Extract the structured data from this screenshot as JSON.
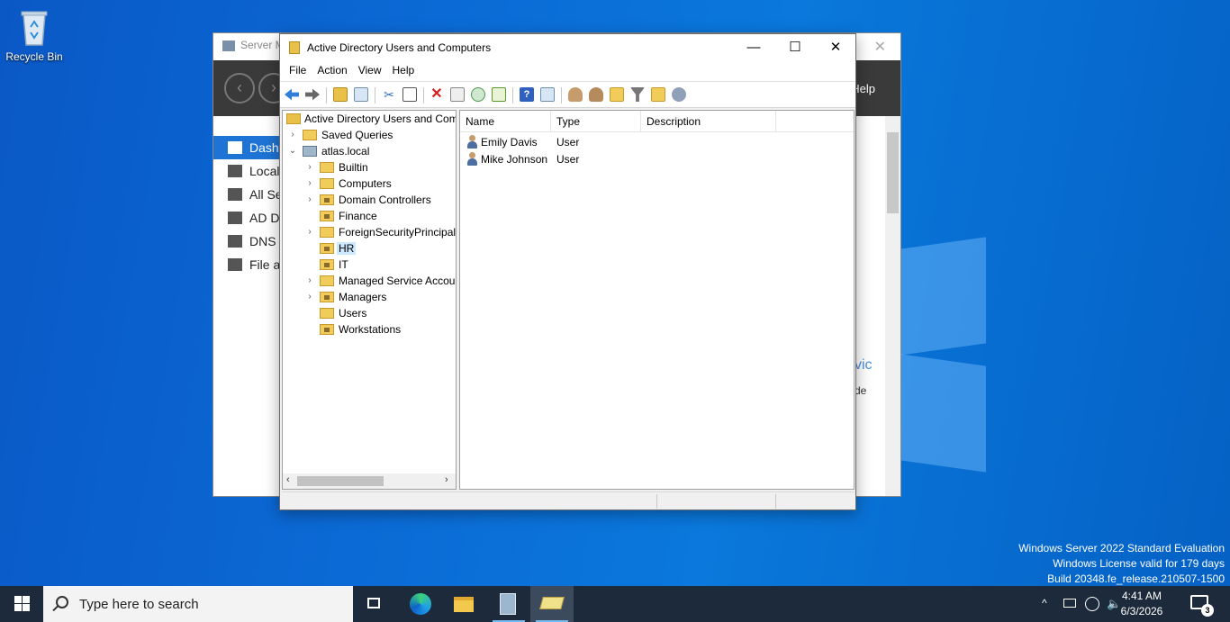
{
  "desktop": {
    "recycle_bin_label": "Recycle Bin",
    "watermark": {
      "line1": "Windows Server 2022 Standard Evaluation",
      "line2": "Windows License valid for 179 days",
      "line3": "Build 20348.fe_release.210507-1500"
    }
  },
  "server_manager": {
    "title": "Server M",
    "help_label": "Help",
    "sidebar": [
      {
        "label": "Dashb",
        "icon": "dashboard-icon",
        "active": true
      },
      {
        "label": "Local",
        "icon": "local-server-icon"
      },
      {
        "label": "All Se",
        "icon": "all-servers-icon"
      },
      {
        "label": "AD D",
        "icon": "ad-ds-icon"
      },
      {
        "label": "DNS",
        "icon": "dns-icon"
      },
      {
        "label": "File a",
        "icon": "file-services-icon"
      }
    ],
    "fragment_1": "vic",
    "fragment_2": "de"
  },
  "aduc": {
    "title": "Active Directory Users and Computers",
    "menu": {
      "file": "File",
      "action": "Action",
      "view": "View",
      "help": "Help"
    },
    "tree": {
      "root": "Active Directory Users and Com",
      "saved_queries": "Saved Queries",
      "domain": "atlas.local",
      "children": [
        {
          "label": "Builtin",
          "expandable": true,
          "ou": false
        },
        {
          "label": "Computers",
          "expandable": true,
          "ou": false
        },
        {
          "label": "Domain Controllers",
          "expandable": true,
          "ou": true
        },
        {
          "label": "Finance",
          "expandable": false,
          "ou": true
        },
        {
          "label": "ForeignSecurityPrincipals",
          "expandable": true,
          "ou": false
        },
        {
          "label": "HR",
          "expandable": false,
          "ou": true,
          "selected": true
        },
        {
          "label": "IT",
          "expandable": false,
          "ou": true
        },
        {
          "label": "Managed Service Accour",
          "expandable": true,
          "ou": false
        },
        {
          "label": "Managers",
          "expandable": true,
          "ou": true
        },
        {
          "label": "Users",
          "expandable": false,
          "ou": false
        },
        {
          "label": "Workstations",
          "expandable": false,
          "ou": true
        }
      ]
    },
    "list": {
      "columns": {
        "name": "Name",
        "type": "Type",
        "description": "Description"
      },
      "rows": [
        {
          "name": "Emily Davis",
          "type": "User",
          "description": ""
        },
        {
          "name": "Mike Johnson",
          "type": "User",
          "description": ""
        }
      ]
    }
  },
  "taskbar": {
    "search_placeholder": "Type here to search",
    "time": "4:41 AM",
    "date": "6/3/2026",
    "notification_count": "3"
  }
}
